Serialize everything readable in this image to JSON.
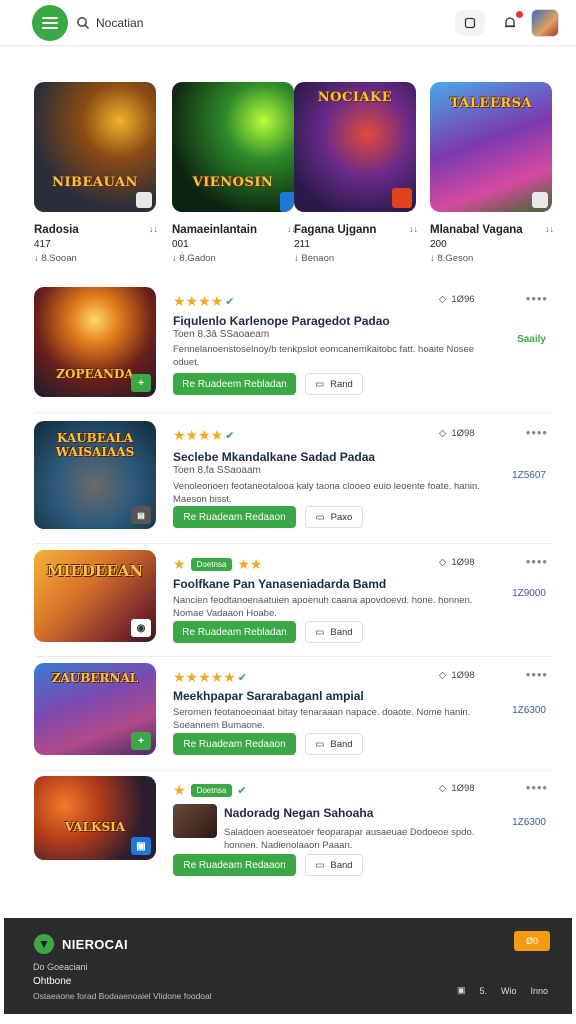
{
  "header": {
    "search_text": "Nocatian",
    "icons": [
      "menu-icon",
      "search-icon",
      "square-icon",
      "bell-icon"
    ]
  },
  "featured": [
    {
      "art": "NIBEAUAN",
      "title": "Radosia",
      "dl_label": "↓↓",
      "count": "417",
      "downloads": "↓ 8.Sooan"
    },
    {
      "art": "VIENOSIN",
      "title": "Namaeinlantain",
      "dl_label": "↓↓",
      "count": "001",
      "downloads": "↓ 8.Gadon"
    },
    {
      "art": "NOCIAKE",
      "title": "Fagana Ujgann",
      "dl_label": "↓↓",
      "count": "211",
      "downloads": "↓ Benaon"
    },
    {
      "art": "TALEERSA",
      "title": "Mlanabal Vagana",
      "dl_label": "↓↓",
      "count": "200",
      "downloads": "↓ 8.Geson"
    }
  ],
  "list": [
    {
      "art": "ZOPEANDA",
      "reviews": "1Ø96",
      "title": "Fiqulenlo Karlenope Paragedot Padao",
      "sub": "Toen 8.3ā SSaoaeam",
      "desc": "Fennelanoenstoselnoy/b tenkpslot eomcanemkaitobc fatt. hoaite Nosee oduet.",
      "side": "Saaily",
      "get": "Re Ruadeem Rebladan",
      "save": "Rand"
    },
    {
      "art": "KAUBEALA WAISAIAAS",
      "reviews": "1Ø98",
      "title": "Seclebe Mkandalkane Sadad Padaa",
      "sub": "Toen 8.fa SSaoaam",
      "desc": "Venoleonoen feotaneotalooa kaly taona clooeo euio leoente foate. hanin. Maeson bisst.",
      "side": "1Z5607",
      "get": "Re Ruadeam Redaaon",
      "save": "Paxo"
    },
    {
      "art": "MIEDEEAN",
      "badge": "Doetnsa",
      "reviews": "1Ø98",
      "title": "Foolfkane Pan Yanaseniadarda Bamd",
      "desc": "Nancien feodtanoenaatuien apoenuh caana apovdoevd. hone. honnen. Nomae Vadaaon Hoabe.",
      "side": "1Z9000",
      "get": "Re Ruadeam Rebladan",
      "save": "Band"
    },
    {
      "art": "ZAUBERNAL",
      "reviews": "1Ø98",
      "title": "Meekhpapar Sararabaganl ampial",
      "desc": "Seromen feotanoeonaat bitay tenaraaan napace. doaote. Nome hanin. Soeannem Bumaone.",
      "side": "1Z6300",
      "get": "Re Ruadeam Redaaon",
      "save": "Band"
    },
    {
      "art": "VALKSIA",
      "badge": "Doetnsa",
      "reviews": "1Ø98",
      "title": "Nadoradg Negan Sahoaha",
      "desc": "Saladoen aoeseatoer feoparapar ausaeuae Dodoeoe spdo. honnen. Nadienolaaon Paaan.",
      "side": "1Z6300",
      "get": "Re Ruadeam Redaaon",
      "save": "Band"
    }
  ],
  "footer": {
    "brand": "NIEROCAI",
    "cta": "Ø0",
    "line1": "Do Goeaciani",
    "line2": "Ohtbone",
    "line3": "Ostaeaone forad Bodaaenoaiel Vlidone foodoal",
    "links": [
      "5.",
      "Wio",
      "Inno"
    ]
  },
  "colors": {
    "accent": "#3aa845",
    "star": "#f5a623",
    "footer_bg": "#2b2b2b",
    "footer_cta": "#f39c12"
  }
}
